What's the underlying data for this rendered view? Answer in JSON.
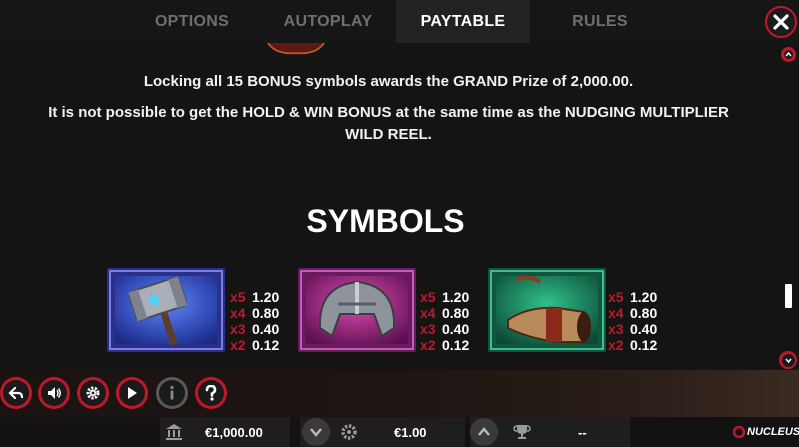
{
  "tabs": [
    {
      "label": "OPTIONS",
      "active": false
    },
    {
      "label": "AUTOPLAY",
      "active": false
    },
    {
      "label": "PAYTABLE",
      "active": true
    },
    {
      "label": "RULES",
      "active": false
    }
  ],
  "content": {
    "paragraph1": "Locking all 15 BONUS symbols awards the GRAND Prize of 2,000.00.",
    "paragraph2_line1": "It is not possible to get the HOLD & WIN BONUS at the same time as the NUDGING MULTIPLIER",
    "paragraph2_line2": "WILD REEL.",
    "section_title": "SYMBOLS",
    "symbols": [
      {
        "name": "hammer",
        "payouts": [
          {
            "mult": "x5",
            "value": "1.20"
          },
          {
            "mult": "x4",
            "value": "0.80"
          },
          {
            "mult": "x3",
            "value": "0.40"
          },
          {
            "mult": "x2",
            "value": "0.12"
          }
        ]
      },
      {
        "name": "helmet",
        "payouts": [
          {
            "mult": "x5",
            "value": "1.20"
          },
          {
            "mult": "x4",
            "value": "0.80"
          },
          {
            "mult": "x3",
            "value": "0.40"
          },
          {
            "mult": "x2",
            "value": "0.12"
          }
        ]
      },
      {
        "name": "horn",
        "payouts": [
          {
            "mult": "x5",
            "value": "1.20"
          },
          {
            "mult": "x4",
            "value": "0.80"
          },
          {
            "mult": "x3",
            "value": "0.40"
          },
          {
            "mult": "x2",
            "value": "0.12"
          }
        ]
      }
    ]
  },
  "controls": [
    "back-icon",
    "sound-icon",
    "settings-icon",
    "play-icon",
    "info-icon",
    "help-icon"
  ],
  "footer": {
    "balance": "€1,000.00",
    "bet": "€1.00",
    "win": "--",
    "brand": "NUCLEUS"
  },
  "colors": {
    "accent": "#c0182a",
    "background": "#141414"
  }
}
